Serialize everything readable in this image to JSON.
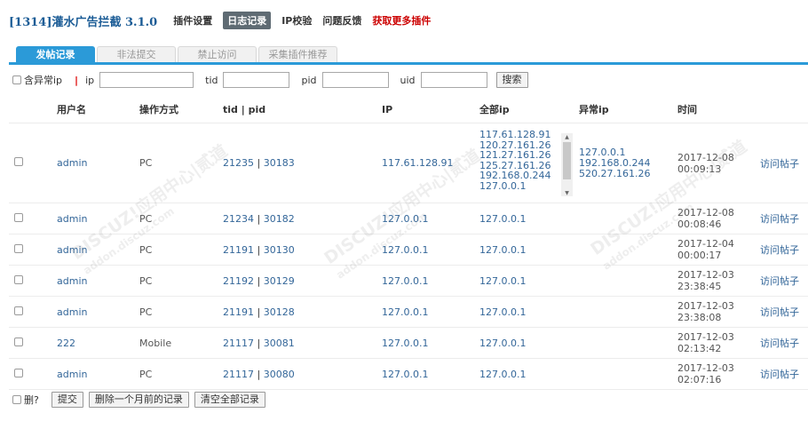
{
  "header": {
    "title": "[1314]灌水广告拦截 3.1.0",
    "nav": [
      "插件设置",
      "日志记录",
      "IP校验",
      "问题反馈",
      "获取更多插件"
    ]
  },
  "tabs": [
    "发帖记录",
    "非法提交",
    "禁止访问",
    "采集插件推荐"
  ],
  "filter": {
    "abnormal_label": "含异常ip",
    "ip_label": "ip",
    "tid_label": "tid",
    "pid_label": "pid",
    "uid_label": "uid",
    "search_label": "搜索"
  },
  "table": {
    "columns": [
      "用户名",
      "操作方式",
      "tid | pid",
      "IP",
      "全部ip",
      "异常ip",
      "时间"
    ],
    "rows": [
      {
        "user": "admin",
        "op": "PC",
        "tid": "21235",
        "pid": "30183",
        "ip": "117.61.128.91",
        "allip": [
          "117.61.128.91",
          "120.27.161.26",
          "121.27.161.26",
          "125.27.161.26",
          "192.168.0.244",
          "127.0.0.1"
        ],
        "abip": [
          "127.0.0.1",
          "192.168.0.244",
          "520.27.161.26"
        ],
        "date": "2017-12-08",
        "time": "00:09:13",
        "link": "访问帖子"
      },
      {
        "user": "admin",
        "op": "PC",
        "tid": "21234",
        "pid": "30182",
        "ip": "127.0.0.1",
        "allip": [
          "127.0.0.1"
        ],
        "abip": [],
        "date": "2017-12-08",
        "time": "00:08:46",
        "link": "访问帖子"
      },
      {
        "user": "admin",
        "op": "PC",
        "tid": "21191",
        "pid": "30130",
        "ip": "127.0.0.1",
        "allip": [
          "127.0.0.1"
        ],
        "abip": [],
        "date": "2017-12-04",
        "time": "00:00:17",
        "link": "访问帖子"
      },
      {
        "user": "admin",
        "op": "PC",
        "tid": "21192",
        "pid": "30129",
        "ip": "127.0.0.1",
        "allip": [
          "127.0.0.1"
        ],
        "abip": [],
        "date": "2017-12-03",
        "time": "23:38:45",
        "link": "访问帖子"
      },
      {
        "user": "admin",
        "op": "PC",
        "tid": "21191",
        "pid": "30128",
        "ip": "127.0.0.1",
        "allip": [
          "127.0.0.1"
        ],
        "abip": [],
        "date": "2017-12-03",
        "time": "23:38:08",
        "link": "访问帖子"
      },
      {
        "user": "222",
        "op": "Mobile",
        "tid": "21117",
        "pid": "30081",
        "ip": "127.0.0.1",
        "allip": [
          "127.0.0.1"
        ],
        "abip": [],
        "date": "2017-12-03",
        "time": "02:13:42",
        "link": "访问帖子"
      },
      {
        "user": "admin",
        "op": "PC",
        "tid": "21117",
        "pid": "30080",
        "ip": "127.0.0.1",
        "allip": [
          "127.0.0.1"
        ],
        "abip": [],
        "date": "2017-12-03",
        "time": "02:07:16",
        "link": "访问帖子"
      }
    ]
  },
  "bottom": {
    "delete_label": "删?",
    "submit_label": "提交",
    "delete_month_label": "删除一个月前的记录",
    "clear_all_label": "清空全部记录"
  },
  "watermark": {
    "text": "DISCUZ!应用中心|贰道",
    "sub": "addon.discuz.com"
  },
  "colors": {
    "accent": "#2b9ad8",
    "link": "#336699",
    "danger": "#cc0000"
  }
}
